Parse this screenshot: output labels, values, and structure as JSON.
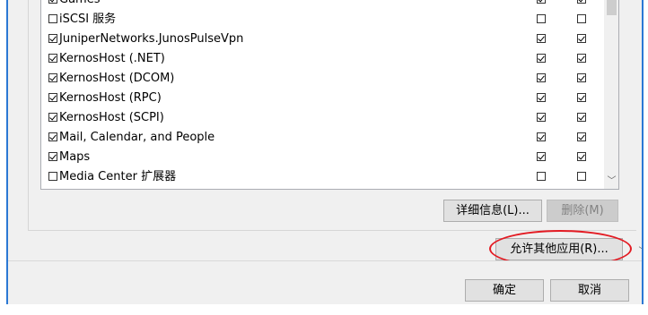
{
  "app_list": {
    "rows": [
      {
        "name": "Games",
        "enabled": true,
        "private": true,
        "public": true,
        "partial": true
      },
      {
        "name": "iSCSI 服务",
        "enabled": false,
        "private": false,
        "public": false
      },
      {
        "name": "JuniperNetworks.JunosPulseVpn",
        "enabled": true,
        "private": true,
        "public": true
      },
      {
        "name": "KernosHost (.NET)",
        "enabled": true,
        "private": true,
        "public": true
      },
      {
        "name": "KernosHost (DCOM)",
        "enabled": true,
        "private": true,
        "public": true
      },
      {
        "name": "KernosHost (RPC)",
        "enabled": true,
        "private": true,
        "public": true
      },
      {
        "name": "KernosHost (SCPI)",
        "enabled": true,
        "private": true,
        "public": true
      },
      {
        "name": "Mail, Calendar, and People",
        "enabled": true,
        "private": true,
        "public": true
      },
      {
        "name": "Maps",
        "enabled": true,
        "private": true,
        "public": true
      },
      {
        "name": "Media Center 扩展器",
        "enabled": false,
        "private": false,
        "public": false
      }
    ],
    "scroll_down_glyph": "﹀"
  },
  "buttons": {
    "details": "详细信息(L)...",
    "remove": "删除(M)",
    "allow_other_app": "允许其他应用(R)...",
    "ok": "确定",
    "cancel": "取消"
  },
  "colors": {
    "window_border": "#2b78d4",
    "highlight": "#e31b23"
  },
  "outer_scroll_down_glyph": "﹀"
}
